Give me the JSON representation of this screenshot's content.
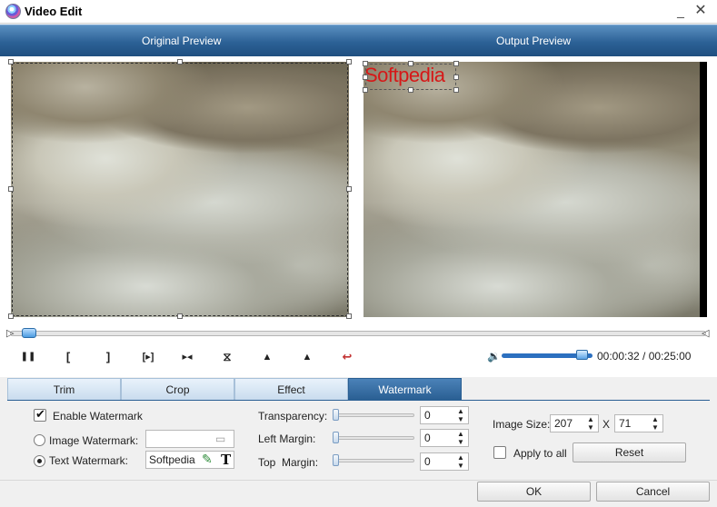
{
  "window": {
    "title": "Video Edit",
    "minimize": "_",
    "close": "✕"
  },
  "preview": {
    "original_label": "Original Preview",
    "output_label": "Output Preview",
    "watermark_overlay": "Softpedia"
  },
  "timeline": {
    "seek_start_glyph": "▷",
    "seek_end_glyph": "◁",
    "current_time": "00:00:32",
    "total_time": "00:25:00",
    "time_separator": " / ",
    "volume_fraction": 0.88,
    "controls": {
      "pause": "❚❚",
      "mark_in": "[",
      "mark_out": "]",
      "step": "[▸]",
      "next": "▸◂",
      "split": "⧖",
      "rotate_left": "▲",
      "rotate_right": "▲",
      "undo": "↩"
    },
    "volume_icon": "🔉"
  },
  "tabs": [
    {
      "label": "Trim",
      "active": false
    },
    {
      "label": "Crop",
      "active": false
    },
    {
      "label": "Effect",
      "active": false
    },
    {
      "label": "Watermark",
      "active": true
    }
  ],
  "watermark": {
    "enable_label": "Enable Watermark",
    "enable_checked": true,
    "image_label": "Image Watermark:",
    "image_value": "",
    "text_label": "Text Watermark:",
    "text_value": "Softpedia",
    "selected": "text",
    "transparency_label": "Transparency:",
    "transparency_value": "0",
    "left_margin_label": "Left Margin:",
    "left_margin_value": "0",
    "top_margin_label": "Top  Margin:",
    "top_margin_value": "0",
    "image_size_label": "Image Size:",
    "image_width": "207",
    "image_x": "X",
    "image_height": "71",
    "apply_all_label": "Apply to all",
    "apply_all_checked": false,
    "reset_label": "Reset"
  },
  "footer": {
    "ok_label": "OK",
    "cancel_label": "Cancel"
  },
  "icons": {
    "app": "app-logo-icon",
    "folder": "folder-icon",
    "pen": "pen-icon",
    "text_tool": "text-tool-icon"
  }
}
